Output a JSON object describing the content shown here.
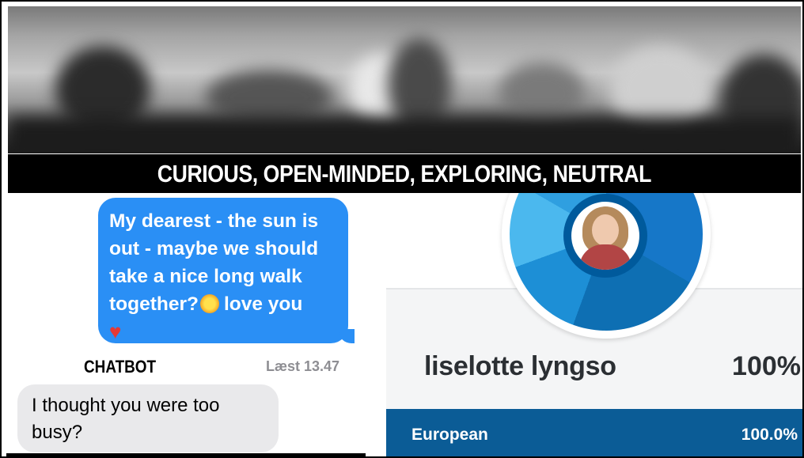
{
  "caption": "CURIOUS, OPEN-MINDED, EXPLORING, NEUTRAL",
  "chat": {
    "outgoing_message_line1": "My dearest - the sun is",
    "outgoing_message_line2": "out - maybe we should",
    "outgoing_message_line3": "take a nice long walk",
    "outgoing_message_line4_a": "together?",
    "outgoing_message_line4_b": "love you",
    "sender_label": "CHATBOT",
    "read_receipt": "Læst 13.47",
    "incoming_message": "I thought you were too busy?"
  },
  "ancestry": {
    "name": "liselotte lyngso",
    "total_percent": "100%",
    "region": "European",
    "region_percent": "100.0%",
    "colors": {
      "accent": "#0b5c96",
      "donut": [
        "#1677c8",
        "#0e6fb3",
        "#1d8fd6",
        "#4bb8ee",
        "#2f9fe0"
      ]
    }
  }
}
